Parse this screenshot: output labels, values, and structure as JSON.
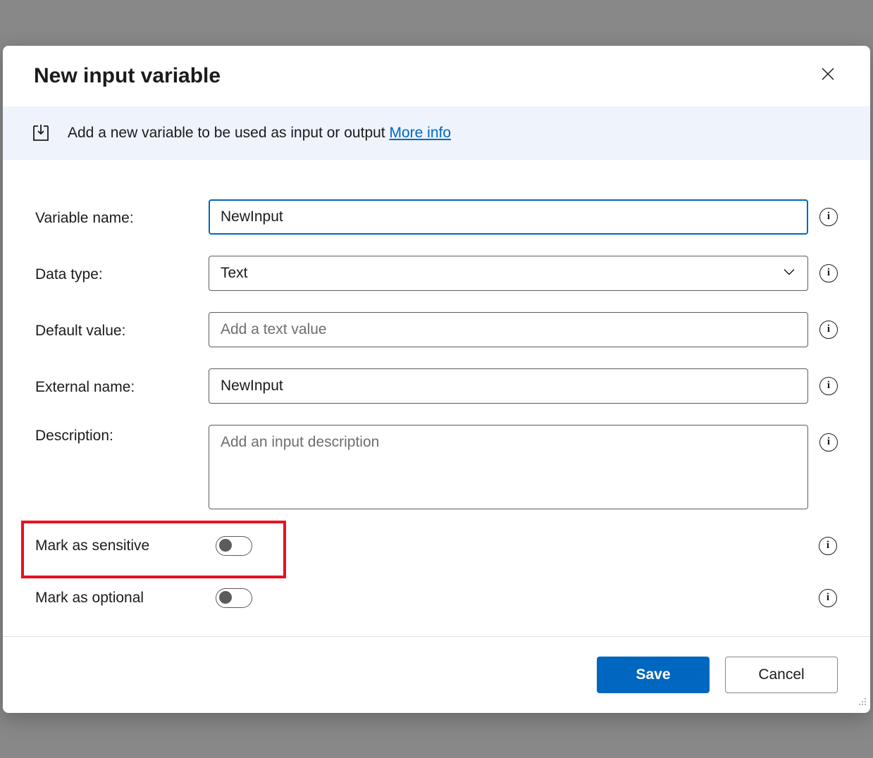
{
  "dialog": {
    "title": "New input variable",
    "banner_text": "Add a new variable to be used as input or output ",
    "more_info": "More info"
  },
  "labels": {
    "variable_name": "Variable name:",
    "data_type": "Data type:",
    "default_value": "Default value:",
    "external_name": "External name:",
    "description": "Description:",
    "mark_sensitive": "Mark as sensitive",
    "mark_optional": "Mark as optional"
  },
  "values": {
    "variable_name": "NewInput",
    "data_type": "Text",
    "default_value": "",
    "default_value_placeholder": "Add a text value",
    "external_name": "NewInput",
    "description": "",
    "description_placeholder": "Add an input description",
    "mark_sensitive_on": false,
    "mark_optional_on": false
  },
  "footer": {
    "save": "Save",
    "cancel": "Cancel"
  },
  "info_char": "i"
}
